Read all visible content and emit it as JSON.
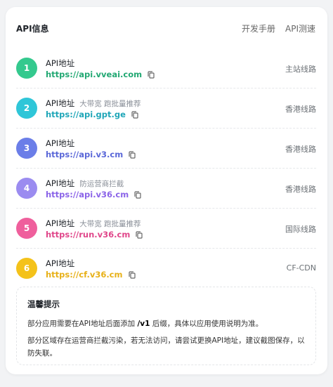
{
  "header": {
    "title": "API信息",
    "links": [
      "开发手册",
      "API测速"
    ]
  },
  "colors": {
    "badge": [
      "#34c98e",
      "#2fc6d8",
      "#6b7ee8",
      "#9b8cf0",
      "#ef5f9c",
      "#f4c21a"
    ],
    "url": [
      "#22a873",
      "#1fa6b8",
      "#5a67d8",
      "#8a63e8",
      "#e0468a",
      "#e7b017"
    ]
  },
  "routes": [
    {
      "num": "1",
      "label": "API地址",
      "tag": "",
      "url": "https://api.vveai.com",
      "route": "主站线路"
    },
    {
      "num": "2",
      "label": "API地址",
      "tag": "大带宽 跑批量推荐",
      "url": "https://api.gpt.ge",
      "route": "香港线路"
    },
    {
      "num": "3",
      "label": "API地址",
      "tag": "",
      "url": "https://api.v3.cm",
      "route": "香港线路"
    },
    {
      "num": "4",
      "label": "API地址",
      "tag": "防运营商拦截",
      "url": "https://api.v36.cm",
      "route": "香港线路"
    },
    {
      "num": "5",
      "label": "API地址",
      "tag": "大带宽 跑批量推荐",
      "url": "https://run.v36.cm",
      "route": "国际线路"
    },
    {
      "num": "6",
      "label": "API地址",
      "tag": "",
      "url": "https://cf.v36.cm",
      "route": "CF-CDN"
    }
  ],
  "tips": {
    "title": "温馨提示",
    "line1_pre": "部分应用需要在API地址后面添加 ",
    "line1_bold": "/v1",
    "line1_post": " 后缀，具体以应用使用说明为准。",
    "line2": "部分区域存在运营商拦截污染，若无法访问，请尝试更换API地址，建议截图保存，以防失联。"
  }
}
